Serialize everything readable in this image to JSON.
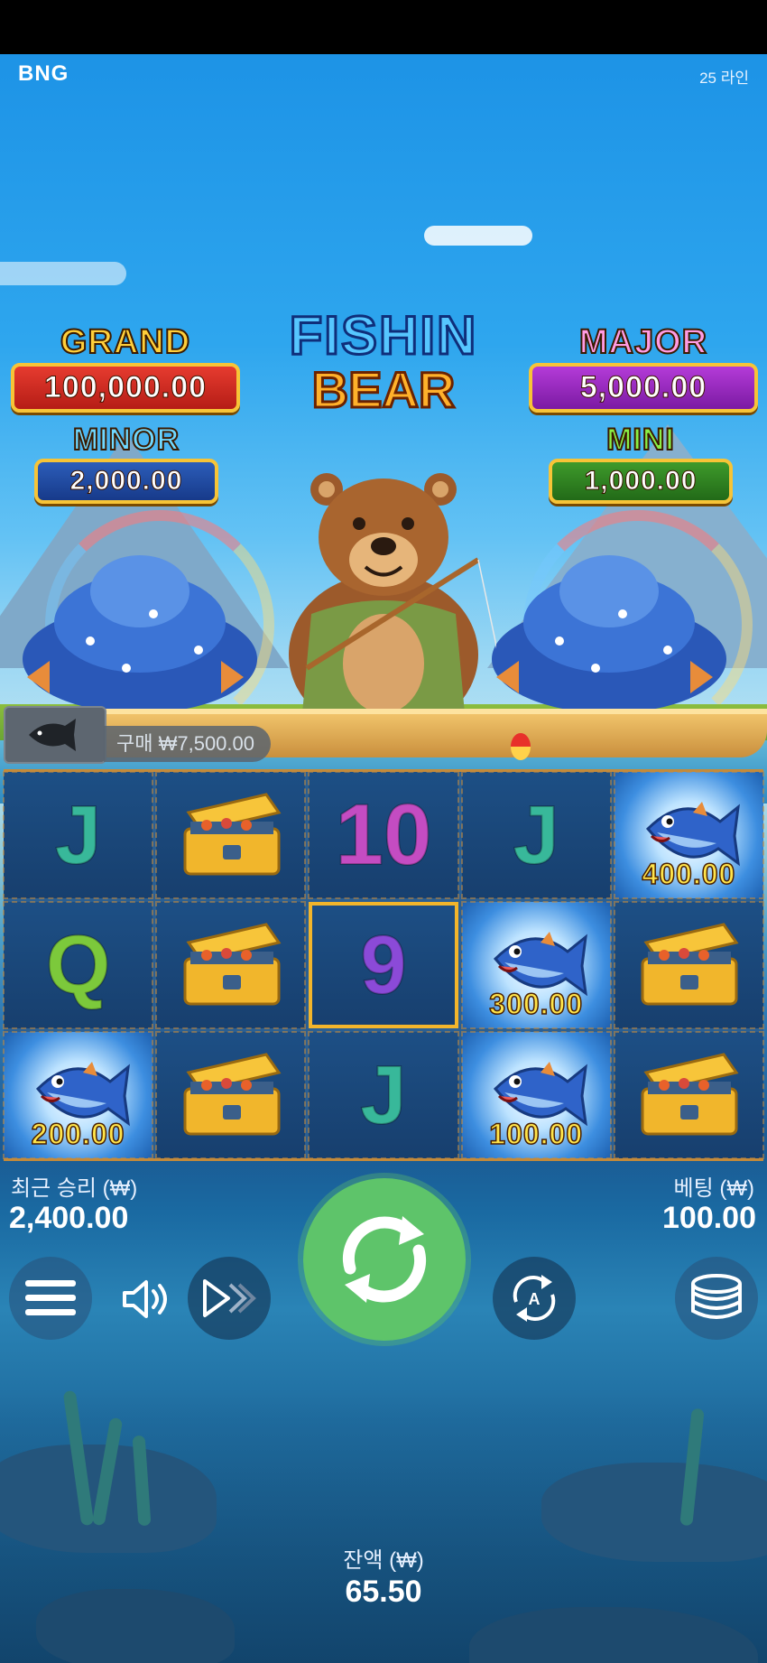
{
  "header": {
    "brand": "BNG",
    "lines": "25 라인"
  },
  "logo": {
    "line1": "FISHIN",
    "line2": "BEAR"
  },
  "jackpots": {
    "grand": {
      "label": "GRAND",
      "value": "100,000.00"
    },
    "major": {
      "label": "MAJOR",
      "value": "5,000.00"
    },
    "minor": {
      "label": "MINOR",
      "value": "2,000.00"
    },
    "mini": {
      "label": "MINI",
      "value": "1,000.00"
    }
  },
  "buy": {
    "label": "구매 ₩7,500.00",
    "icon": "fish-icon"
  },
  "reels": {
    "rows": [
      [
        {
          "type": "letter",
          "symbol": "J"
        },
        {
          "type": "chest"
        },
        {
          "type": "letter",
          "symbol": "10"
        },
        {
          "type": "letter",
          "symbol": "J"
        },
        {
          "type": "fish",
          "value": "400.00"
        }
      ],
      [
        {
          "type": "letter",
          "symbol": "Q"
        },
        {
          "type": "chest"
        },
        {
          "type": "letter",
          "symbol": "9",
          "highlight": true
        },
        {
          "type": "fish",
          "value": "300.00"
        },
        {
          "type": "chest"
        }
      ],
      [
        {
          "type": "fish",
          "value": "200.00"
        },
        {
          "type": "chest"
        },
        {
          "type": "letter",
          "symbol": "J"
        },
        {
          "type": "fish",
          "value": "100.00"
        },
        {
          "type": "chest"
        }
      ]
    ]
  },
  "stats": {
    "last_win_label": "최근 승리 (₩)",
    "last_win_value": "2,400.00",
    "bet_label": "베팅 (₩)",
    "bet_value": "100.00",
    "balance_label": "잔액 (₩)",
    "balance_value": "65.50"
  },
  "controls": {
    "menu_icon": "menu-icon",
    "sound_icon": "speaker-icon",
    "turbo_icon": "fast-forward-icon",
    "spin_icon": "spin-icon",
    "autoplay_icon": "autoplay-icon",
    "bet_icon": "coin-stack-icon"
  },
  "colors": {
    "spin": "#5ec46a",
    "grand": "#e63b2f",
    "major": "#b43bd8",
    "minor": "#2c5db9",
    "mini": "#3e9a2b"
  }
}
